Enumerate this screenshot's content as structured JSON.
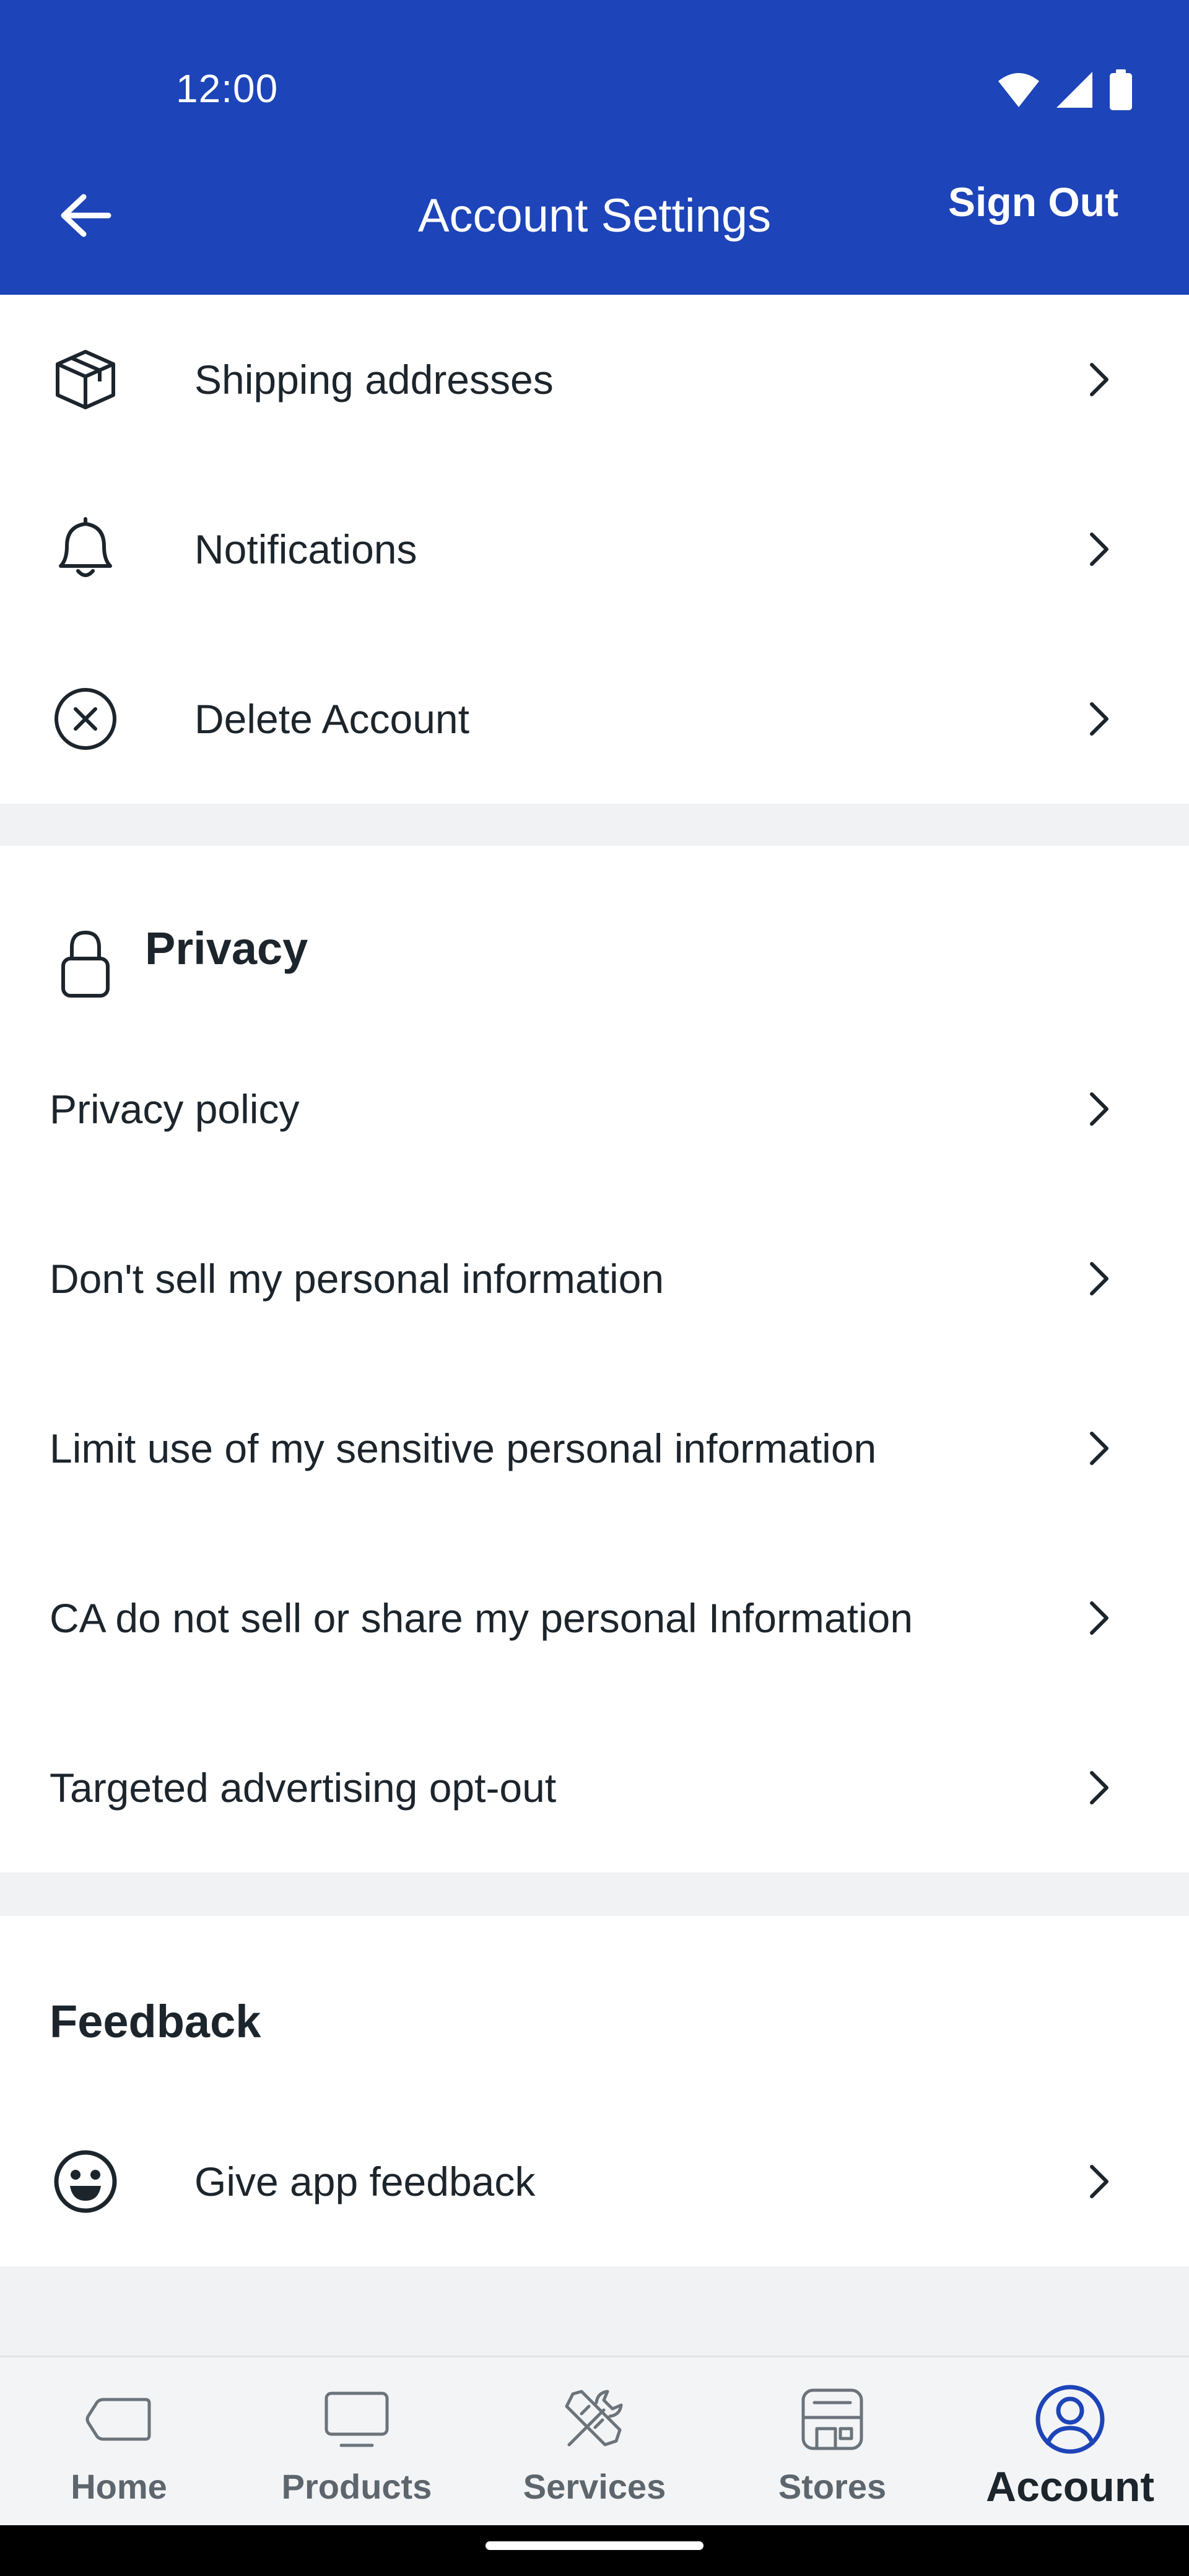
{
  "status_bar": {
    "time": "12:00"
  },
  "header": {
    "title": "Account Settings",
    "sign_out_label": "Sign Out"
  },
  "account_items": [
    {
      "label": "Shipping addresses",
      "icon": "box-icon"
    },
    {
      "label": "Notifications",
      "icon": "bell-icon"
    },
    {
      "label": "Delete Account",
      "icon": "circle-x-icon"
    }
  ],
  "privacy": {
    "title": "Privacy",
    "items": [
      {
        "label": "Privacy policy"
      },
      {
        "label": "Don't sell my personal information"
      },
      {
        "label": "Limit use of my sensitive personal information"
      },
      {
        "label": "CA do not sell or share my personal Information"
      },
      {
        "label": "Targeted advertising opt-out"
      }
    ]
  },
  "feedback": {
    "title": "Feedback",
    "items": [
      {
        "label": "Give app feedback",
        "icon": "smiley-icon"
      }
    ]
  },
  "bottom_nav": {
    "items": [
      {
        "label": "Home",
        "icon": "home-tag-icon",
        "active": false
      },
      {
        "label": "Products",
        "icon": "monitor-icon",
        "active": false
      },
      {
        "label": "Services",
        "icon": "tools-icon",
        "active": false
      },
      {
        "label": "Stores",
        "icon": "store-icon",
        "active": false
      },
      {
        "label": "Account",
        "icon": "user-circle-icon",
        "active": true
      }
    ]
  },
  "colors": {
    "brand_blue": "#1d44b8",
    "text": "#1d252c",
    "nav_inactive": "#5d656d",
    "background": "#f0f2f4"
  }
}
